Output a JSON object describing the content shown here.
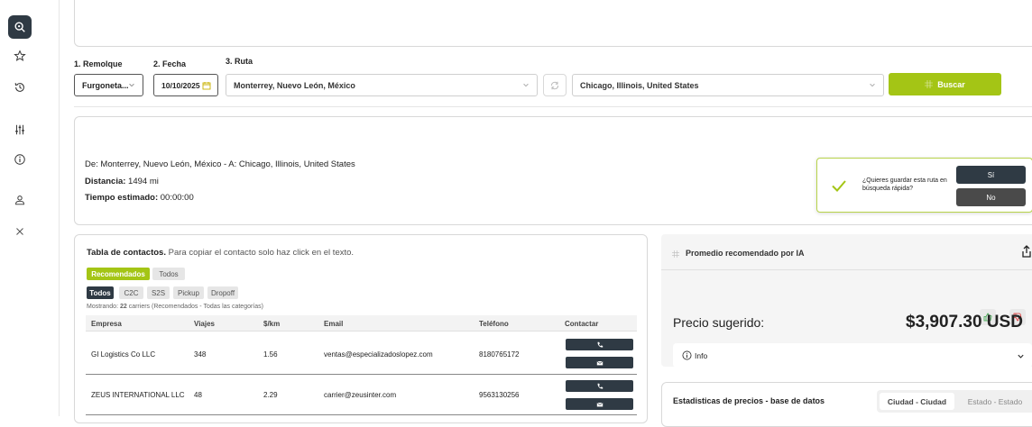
{
  "sidebar": {
    "icons": [
      "search-route-icon",
      "star-icon",
      "history-icon",
      "sliders-icon",
      "info-icon",
      "user-icon",
      "close-icon"
    ],
    "active_color": "#2f3a44"
  },
  "form": {
    "trailer_label": "1. Remolque",
    "trailer_value": "Furgoneta...",
    "date_label": "2. Fecha",
    "date_value": "10/10/2025",
    "route_label": "3. Ruta",
    "origin_value": "Monterrey, Nuevo León, México",
    "destination_value": "Chicago, Illinois, United States",
    "search_label": "Buscar",
    "accent_color": "#a4c515"
  },
  "route_summary": {
    "route_line": "De: Monterrey, Nuevo León, México - A: Chicago, Illinois, United States",
    "distance_label": "Distancia:",
    "distance_value": "1494 mi",
    "time_label": "Tiempo estimado:",
    "time_value": "00:00:00"
  },
  "save_prompt": {
    "question": "¿Quieres guardar esta ruta en búsqueda rápida?",
    "yes_label": "Sí",
    "no_label": "No"
  },
  "contacts": {
    "title_bold": "Tabla de contactos.",
    "title_rest": " Para copiar el contacto solo haz click en el texto.",
    "tabs": [
      "Recomendados",
      "Todos"
    ],
    "filters": [
      "Todos",
      "C2C",
      "S2S",
      "Pickup",
      "Dropoff"
    ],
    "showing_prefix": "Mostrando: ",
    "showing_count": "22",
    "showing_suffix": " carriers (Recomendados - Todas las categorías)",
    "columns": [
      "Empresa",
      "Viajes",
      "$/km",
      "Email",
      "Teléfono",
      "Contactar"
    ],
    "rows": [
      {
        "empresa": "GI Logistics Co LLC",
        "viajes": "348",
        "km": "1.56",
        "email": "ventas@especializadoslopez.com",
        "telefono": "8180765172"
      },
      {
        "empresa": "ZEUS INTERNATIONAL LLC",
        "viajes": "48",
        "km": "2.29",
        "email": "carrier@zeusinter.com",
        "telefono": "9563130256"
      }
    ]
  },
  "ai_panel": {
    "title": "Promedio recomendado por IA",
    "price_label": "Precio sugerido:",
    "price_value": "$3,907.30 USD",
    "info_label": "Info"
  },
  "stats": {
    "title": "Estadisticas de precios - base de datos",
    "segments": [
      "Ciudad - Ciudad",
      "Estado - Estado"
    ]
  }
}
